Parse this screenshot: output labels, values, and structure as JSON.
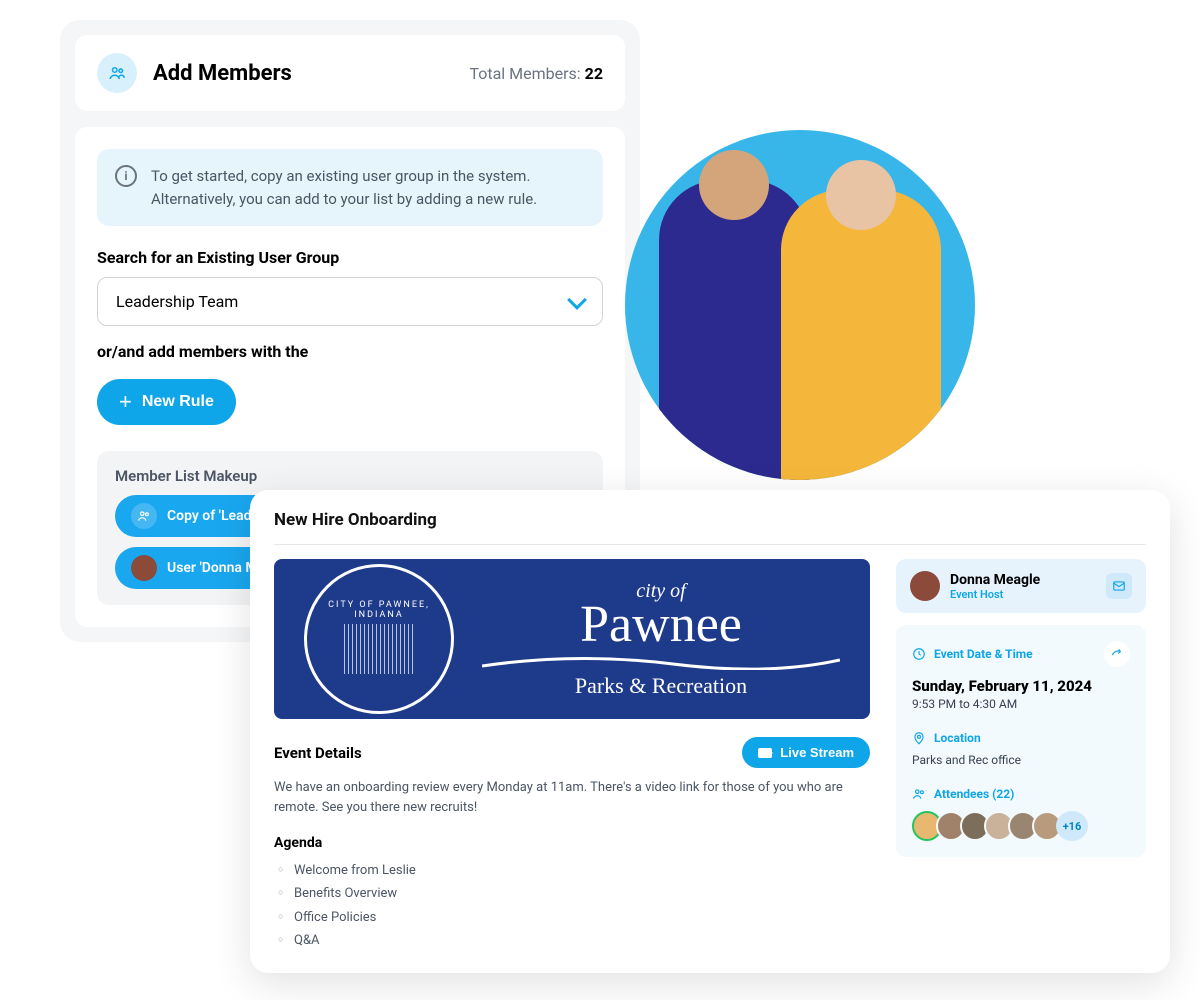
{
  "members": {
    "title": "Add Members",
    "total_label": "Total Members: ",
    "total_count": "22",
    "info": "To get started, copy an existing user group in the system. Alternatively, you can add to your list by adding a new rule.",
    "search_label": "Search for an Existing User Group",
    "select_value": "Leadership Team",
    "subtext": "or/and add members with the",
    "new_rule_label": "New Rule",
    "makeup_title": "Member List Makeup",
    "chips": [
      {
        "label": "Copy of 'Leadership...'"
      },
      {
        "label": "User 'Donna M...'"
      }
    ]
  },
  "event": {
    "title": "New Hire Onboarding",
    "banner": {
      "seal_text": "CITY OF PAWNEE, INDIANA",
      "cityof": "city of",
      "name": "Pawnee",
      "dept": "Parks & Recreation"
    },
    "details_label": "Event Details",
    "live_label": "Live Stream",
    "description": "We have an onboarding review every Monday at 11am. There's a video link for those of you who are remote. See you there new recruits!",
    "agenda_label": "Agenda",
    "agenda": [
      "Welcome from Leslie",
      "Benefits Overview",
      "Office Policies",
      "Q&A"
    ],
    "host": {
      "name": "Donna Meagle",
      "role": "Event Host"
    },
    "datetime_label": "Event Date & Time",
    "date": "Sunday, February 11, 2024",
    "time": "9:53 PM to 4:30 AM",
    "location_label": "Location",
    "location": "Parks and Rec office",
    "attendees_label": "Attendees (22)",
    "attendees_more": "+16"
  }
}
